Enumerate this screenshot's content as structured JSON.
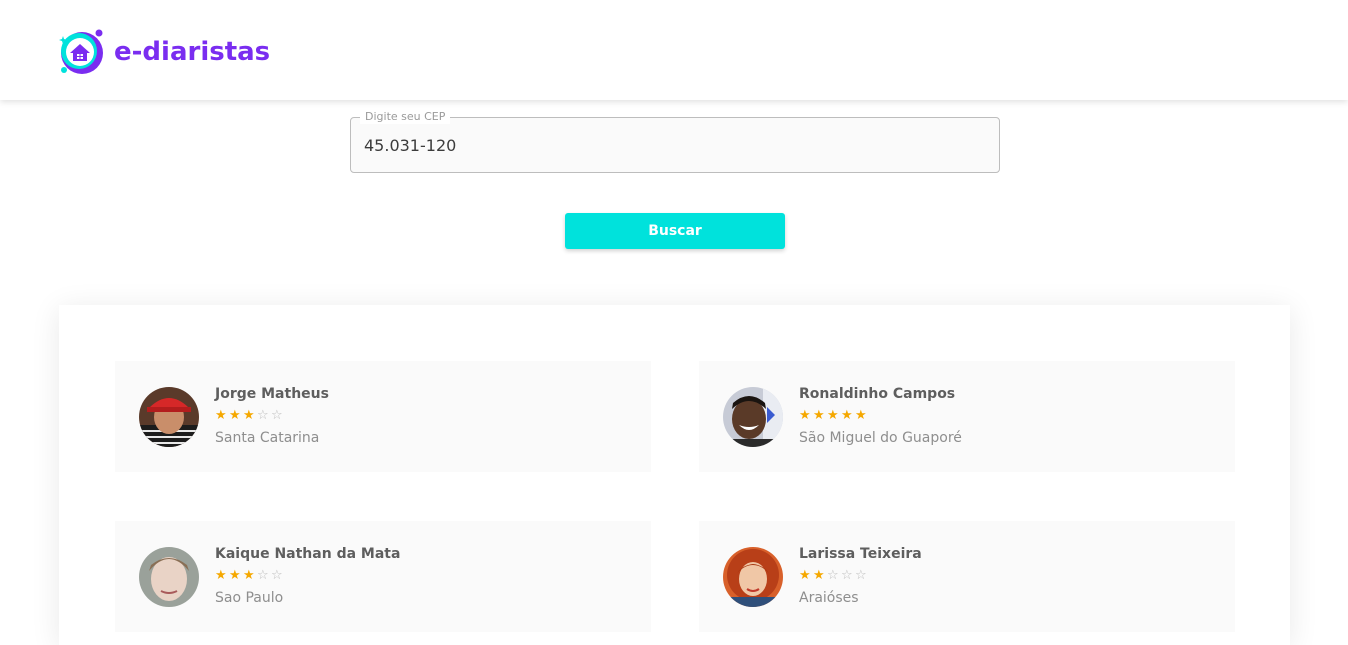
{
  "brand": {
    "name": "e-diaristas",
    "color": "#7a2df0",
    "accent": "#00e2dc"
  },
  "search": {
    "label": "Digite seu CEP",
    "value": "45.031-120",
    "button_label": "Buscar"
  },
  "results": [
    {
      "name": "Jorge Matheus",
      "rating": 3,
      "max_rating": 5,
      "city": "Santa Catarina",
      "stars": "★★★☆☆"
    },
    {
      "name": "Ronaldinho Campos",
      "rating": 5,
      "max_rating": 5,
      "city": "São Miguel do Guaporé",
      "stars": "★★★★★"
    },
    {
      "name": "Kaique Nathan da Mata",
      "rating": 3,
      "max_rating": 5,
      "city": "Sao Paulo",
      "stars": "★★★☆☆"
    },
    {
      "name": "Larissa Teixeira",
      "rating": 2,
      "max_rating": 5,
      "city": "Araióses",
      "stars": "★★☆☆☆"
    }
  ],
  "colors": {
    "star_full": "#f5a800",
    "star_empty": "#bdbdbd"
  }
}
